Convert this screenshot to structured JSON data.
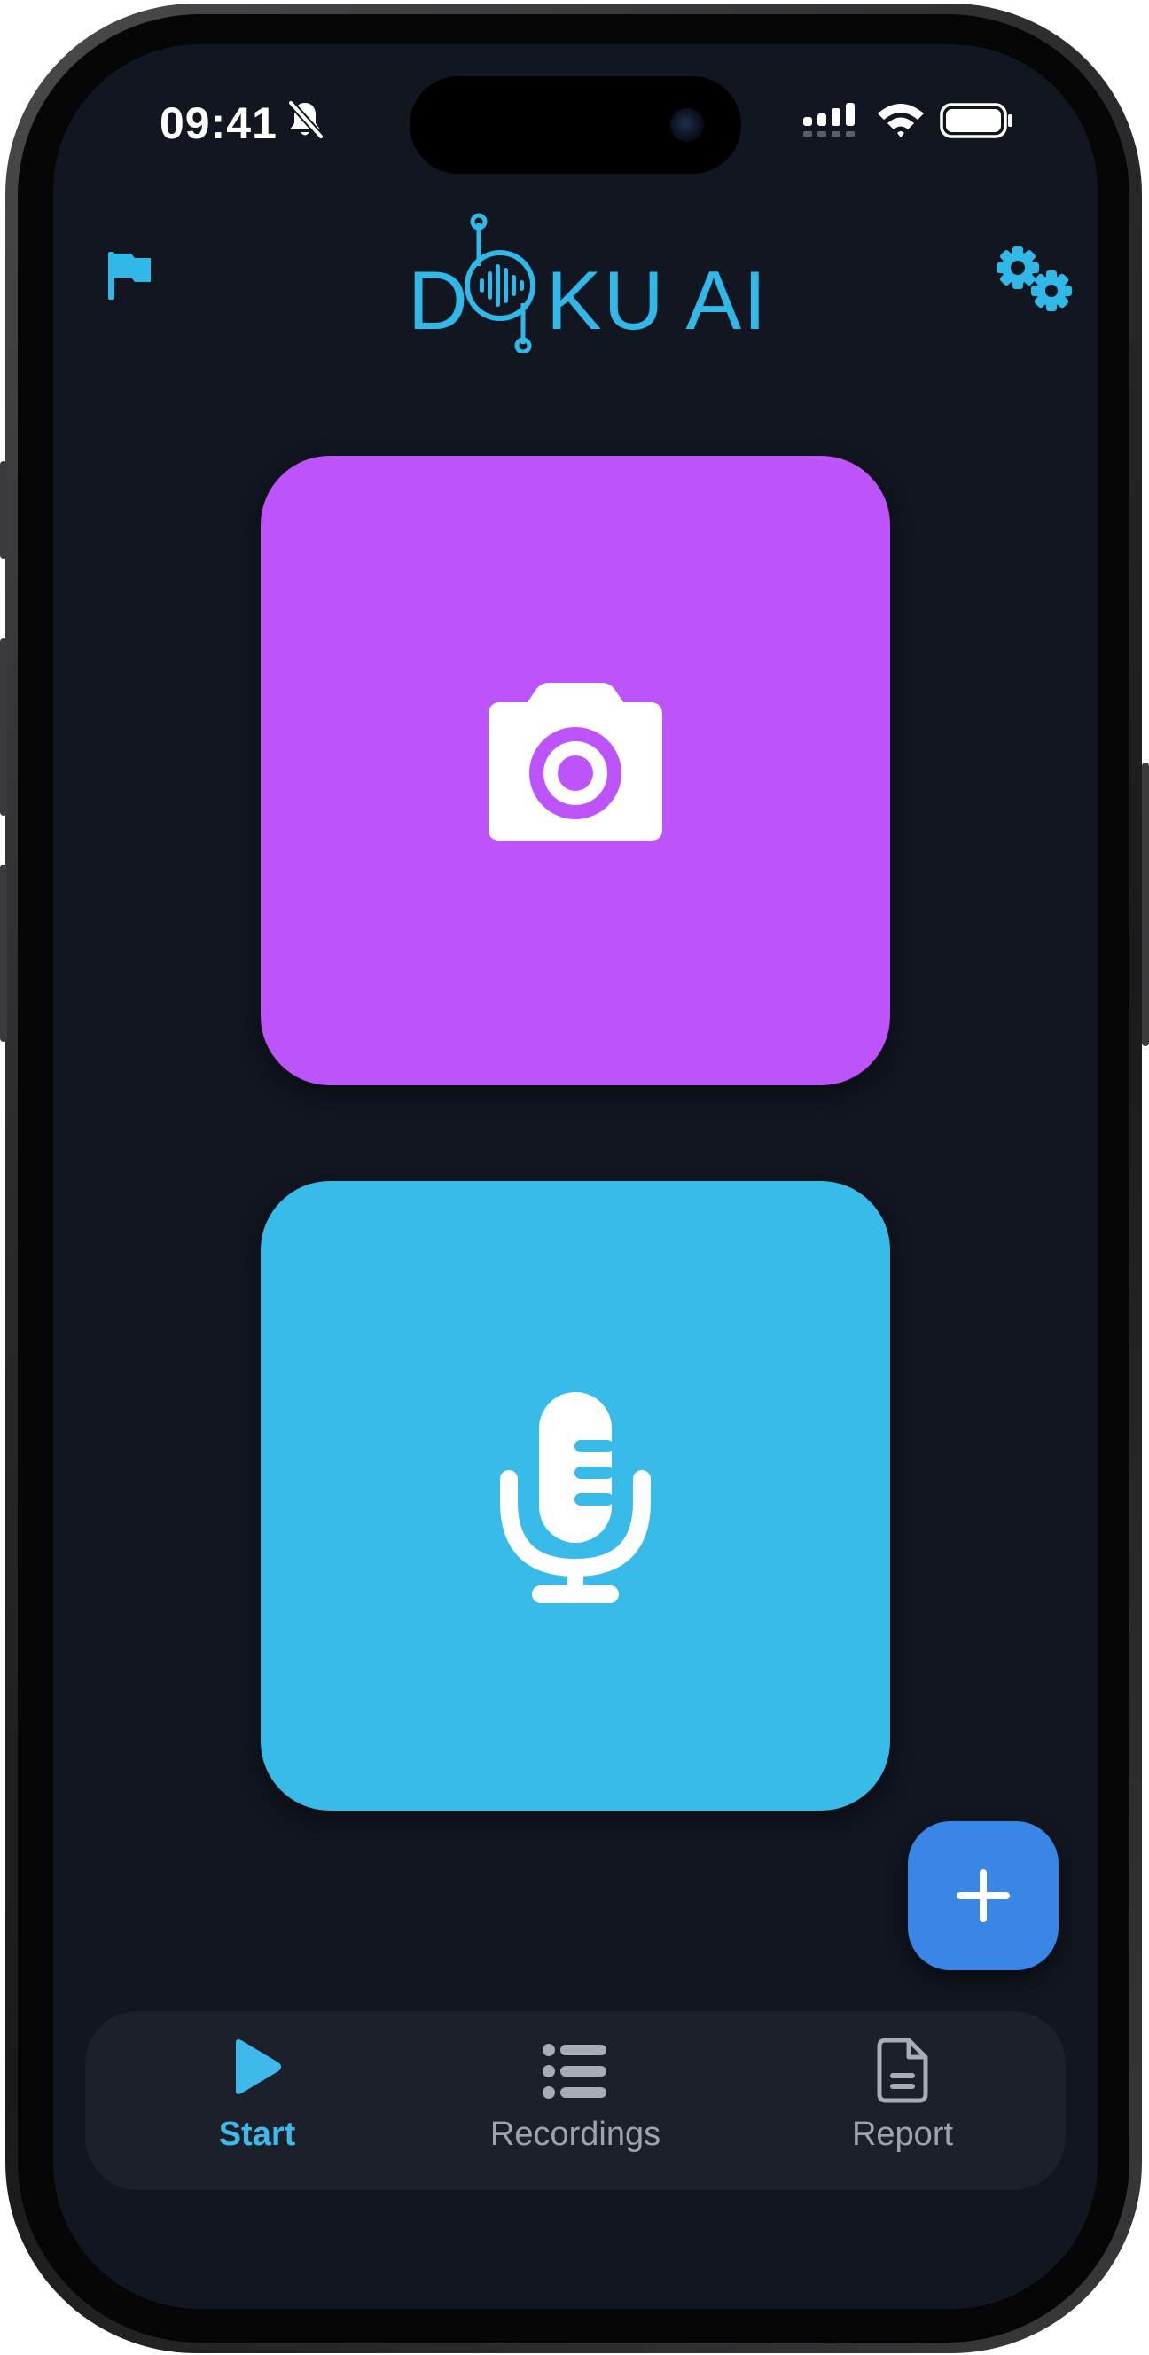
{
  "app": {
    "logo_text_left": "D",
    "logo_text_right": "KU AI",
    "brand_color": "#2fb8e8"
  },
  "status_bar": {
    "time": "09:41",
    "icons": [
      "bell-slash-icon",
      "cellular-signal-icon",
      "wifi-icon",
      "battery-icon"
    ]
  },
  "header": {
    "left_icon": "flag-icon",
    "right_icon": "gear-icon"
  },
  "tiles": [
    {
      "name": "camera",
      "icon": "camera-icon",
      "color": "#bd54fb"
    },
    {
      "name": "microphone",
      "icon": "microphone-icon",
      "color": "#38bbe8"
    }
  ],
  "fab": {
    "icon": "plus-icon",
    "color": "#3a86e6"
  },
  "navbar": {
    "items": [
      {
        "label": "Start",
        "icon": "play-icon",
        "active": true
      },
      {
        "label": "Recordings",
        "icon": "list-icon",
        "active": false
      },
      {
        "label": "Report",
        "icon": "document-icon",
        "active": false
      }
    ],
    "active_color": "#3fb9ea",
    "inactive_color": "#9ea3ad"
  }
}
